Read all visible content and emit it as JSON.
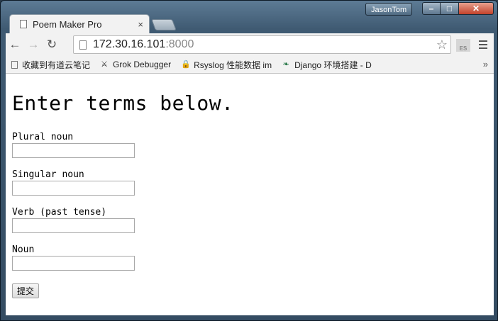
{
  "window": {
    "profile_name": "JasonTom"
  },
  "tab": {
    "title": "Poem Maker Pro",
    "close": "×"
  },
  "omnibox": {
    "host": "172.30.16.101",
    "port": ":8000"
  },
  "extension": {
    "label": "ES"
  },
  "bookmarks": {
    "items": [
      {
        "label": "收藏到有道云笔记",
        "icon": "page-icon"
      },
      {
        "label": "Grok Debugger",
        "icon": "grok-icon"
      },
      {
        "label": "Rsyslog 性能数据 im",
        "icon": "lock-icon"
      },
      {
        "label": "Django 环境搭建 - D",
        "icon": "django-icon"
      }
    ],
    "overflow": "»"
  },
  "page": {
    "heading": "Enter terms below.",
    "fields": [
      {
        "label": "Plural noun",
        "value": ""
      },
      {
        "label": "Singular noun",
        "value": ""
      },
      {
        "label": "Verb (past tense)",
        "value": ""
      },
      {
        "label": "Noun",
        "value": ""
      }
    ],
    "submit_label": "提交"
  }
}
